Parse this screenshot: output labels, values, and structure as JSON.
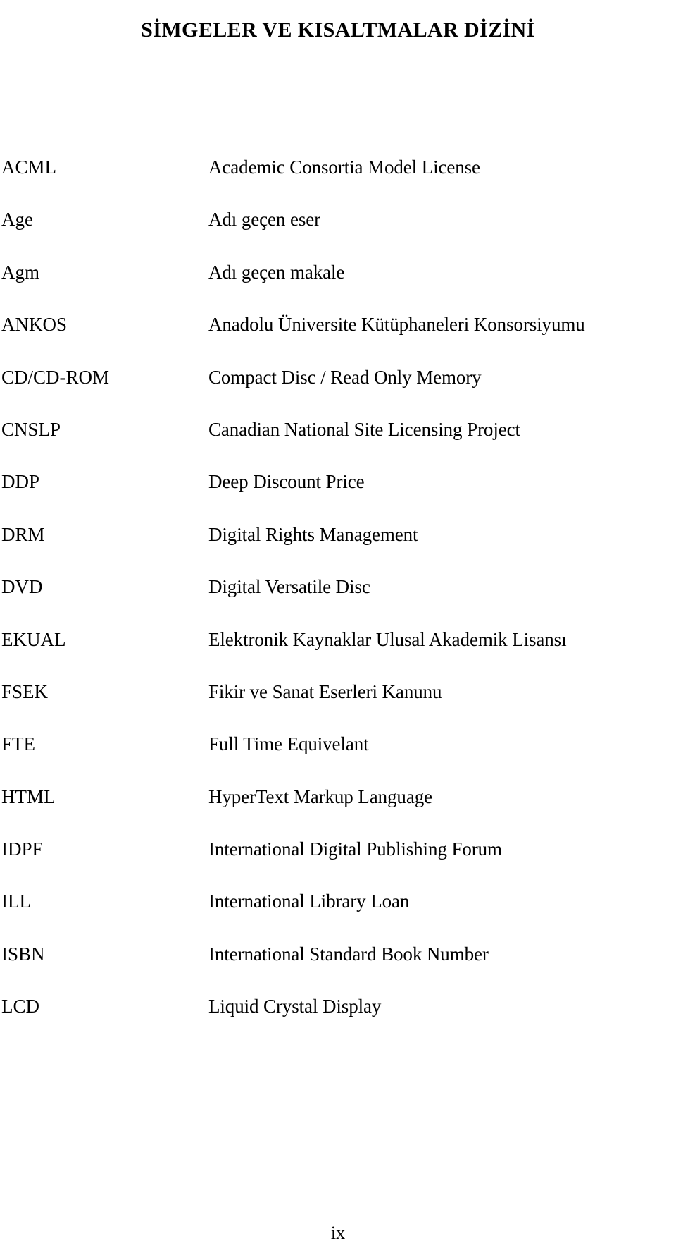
{
  "document": {
    "title": "SİMGELER VE KISALTMALAR DİZİNİ",
    "page_number": "ix"
  },
  "abbreviations": [
    {
      "term": "ACML",
      "definition": "Academic Consortia Model License"
    },
    {
      "term": "Age",
      "definition": "Adı geçen eser"
    },
    {
      "term": "Agm",
      "definition": "Adı geçen makale"
    },
    {
      "term": "ANKOS",
      "definition": "Anadolu Üniversite Kütüphaneleri Konsorsiyumu"
    },
    {
      "term": "CD/CD-ROM",
      "definition": "Compact Disc / Read Only Memory"
    },
    {
      "term": "CNSLP",
      "definition": "Canadian National Site Licensing Project"
    },
    {
      "term": "DDP",
      "definition": "Deep Discount Price"
    },
    {
      "term": "DRM",
      "definition": "Digital Rights Management"
    },
    {
      "term": "DVD",
      "definition": "Digital Versatile Disc"
    },
    {
      "term": "EKUAL",
      "definition": "Elektronik Kaynaklar Ulusal Akademik Lisansı"
    },
    {
      "term": "FSEK",
      "definition": "Fikir ve Sanat Eserleri Kanunu"
    },
    {
      "term": "FTE",
      "definition": "Full Time Equivelant"
    },
    {
      "term": "HTML",
      "definition": "HyperText Markup Language"
    },
    {
      "term": "IDPF",
      "definition": "International Digital Publishing Forum"
    },
    {
      "term": "ILL",
      "definition": "International Library Loan"
    },
    {
      "term": "ISBN",
      "definition": "International Standard Book Number"
    },
    {
      "term": "LCD",
      "definition": "Liquid Crystal Display"
    }
  ]
}
